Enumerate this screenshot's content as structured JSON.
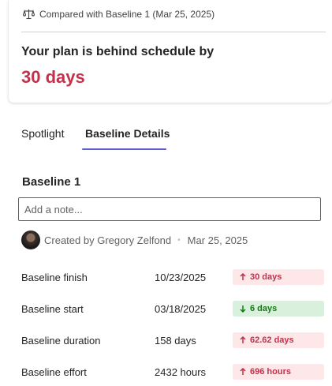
{
  "summary": {
    "compare_icon": "scales-icon",
    "compared_with": "Compared with Baseline 1 (Mar 25, 2025)",
    "title": "Your plan is behind schedule by",
    "delay": "30 days",
    "delay_color": "#c4314b"
  },
  "tabs": [
    {
      "label": "Spotlight",
      "selected": false
    },
    {
      "label": "Baseline Details",
      "selected": true
    }
  ],
  "baseline": {
    "name": "Baseline 1",
    "note_placeholder": "Add a note...",
    "note_value": "",
    "created_by": "Created by Gregory Zelfond",
    "created_date": "Mar 25, 2025",
    "separator": "•"
  },
  "metrics": [
    {
      "label": "Baseline finish",
      "value": "10/23/2025",
      "delta": "30 days",
      "direction": "up",
      "status": "bad"
    },
    {
      "label": "Baseline start",
      "value": "03/18/2025",
      "delta": "6 days",
      "direction": "down",
      "status": "good"
    },
    {
      "label": "Baseline duration",
      "value": "158 days",
      "delta": "62.62 days",
      "direction": "up",
      "status": "bad"
    },
    {
      "label": "Baseline effort",
      "value": "2432 hours",
      "delta": "696 hours",
      "direction": "up",
      "status": "bad"
    }
  ],
  "colors": {
    "accent": "#5b5fc7",
    "bad_text": "#c4314b",
    "bad_bg": "#fde7e9",
    "good_text": "#107c10",
    "good_bg": "#d9f0dd"
  }
}
